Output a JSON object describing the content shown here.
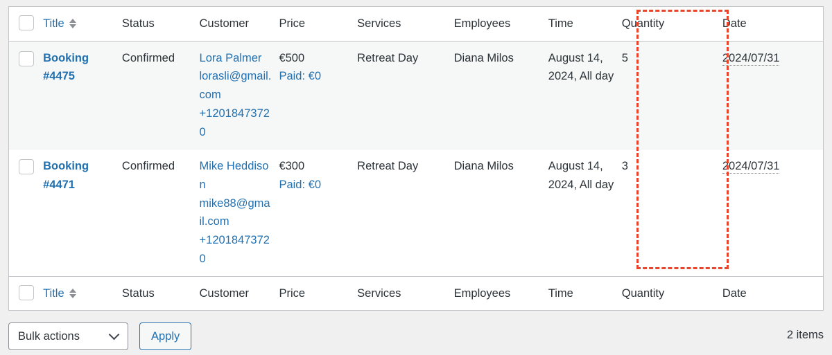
{
  "table": {
    "columns": [
      {
        "key": "checkbox",
        "label": ""
      },
      {
        "key": "title",
        "label": "Title",
        "sortable": true
      },
      {
        "key": "status",
        "label": "Status"
      },
      {
        "key": "customer",
        "label": "Customer"
      },
      {
        "key": "price",
        "label": "Price"
      },
      {
        "key": "services",
        "label": "Services"
      },
      {
        "key": "employees",
        "label": "Employees"
      },
      {
        "key": "time",
        "label": "Time"
      },
      {
        "key": "quantity",
        "label": "Quantity"
      },
      {
        "key": "date",
        "label": "Date"
      }
    ],
    "rows": [
      {
        "title": "Booking #4475",
        "status": "Confirmed",
        "customer_name": "Lora Palmer",
        "customer_email": "lorasli@gmail.com",
        "customer_phone": "+12018473720",
        "price": "€500",
        "paid": "Paid: €0",
        "services": "Retreat Day",
        "employees": "Diana Milos",
        "time": "August 14, 2024, All day",
        "quantity": "5",
        "date": "2024/07/31"
      },
      {
        "title": "Booking #4471",
        "status": "Confirmed",
        "customer_name": "Mike Heddison",
        "customer_email": "mike88@gmail.com",
        "customer_phone": "+12018473720",
        "price": "€300",
        "paid": "Paid: €0",
        "services": "Retreat Day",
        "employees": "Diana Milos",
        "time": "August 14, 2024, All day",
        "quantity": "3",
        "date": "2024/07/31"
      }
    ]
  },
  "highlight": {
    "column": "Quantity",
    "color": "#e8452c",
    "style": "dashed"
  },
  "bottom_bar": {
    "bulk_actions_label": "Bulk actions",
    "apply_label": "Apply",
    "items_count": "2 items"
  },
  "icons": {
    "sort": "sort-arrows-icon",
    "chevron_down": "chevron-down-icon",
    "checkbox": "checkbox-icon"
  },
  "colors": {
    "link": "#2271b1",
    "text": "#2c3338",
    "border": "#c3c4c7",
    "row_alt": "#f6f7f7",
    "page_bg": "#f0f0f1",
    "highlight": "#e8452c"
  }
}
